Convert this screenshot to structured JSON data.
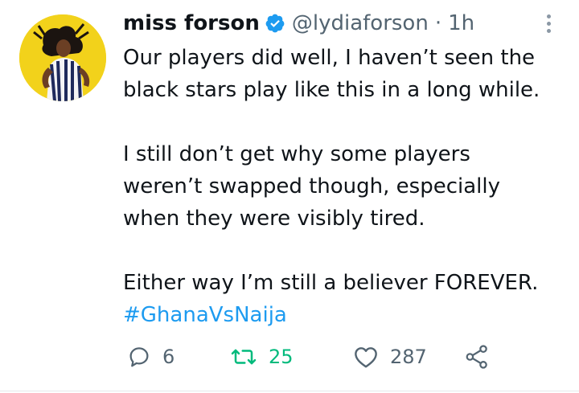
{
  "tweet": {
    "author": {
      "display_name": "miss forson",
      "handle": "@lydiaforson",
      "verified": true,
      "avatar_bg": "#f2d21b"
    },
    "separator": "·",
    "time": "1h",
    "text": {
      "p1_line1": "Our players did well, I haven’t seen the",
      "p1_line2": "black stars play like this in a long while.",
      "p2_line1": "I still don’t get why some players",
      "p2_line2": "weren’t swapped though, especially",
      "p2_line3": "when they were visibly tired.",
      "p3_line1": "Either way I’m still a believer FOREVER.",
      "hashtag": "#GhanaVsNaija"
    },
    "actions": {
      "reply_count": "6",
      "retweet_count": "25",
      "like_count": "287"
    },
    "icons": {
      "verified": "verified-badge-icon",
      "more": "more-vertical-icon",
      "reply": "reply-icon",
      "retweet": "retweet-icon",
      "like": "heart-icon",
      "share": "share-icon"
    },
    "colors": {
      "text": "#0f1419",
      "secondary": "#536471",
      "link": "#1d9bf0",
      "retweet_active": "#00ba7c",
      "verified": "#1d9bf0"
    }
  }
}
